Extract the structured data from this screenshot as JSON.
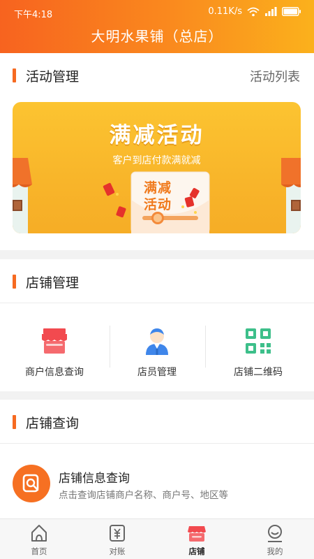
{
  "status_bar": {
    "time": "下午4:18",
    "network_speed": "0.11K/s",
    "battery_level": 1.0
  },
  "header": {
    "title": "大明水果铺（总店）"
  },
  "activity": {
    "section_title": "活动管理",
    "list_link": "活动列表",
    "banner": {
      "title": "满减活动",
      "subtitle": "客户到店付款满就减",
      "envelope_line1": "满减",
      "envelope_line2": "活动"
    }
  },
  "store_mgmt": {
    "section_title": "店铺管理",
    "items": [
      {
        "label": "商户信息查询",
        "icon": "shop-awning-icon"
      },
      {
        "label": "店员管理",
        "icon": "clerk-icon"
      },
      {
        "label": "店铺二维码",
        "icon": "qrcode-icon"
      }
    ]
  },
  "store_query": {
    "section_title": "店铺查询",
    "item": {
      "title": "店铺信息查询",
      "desc": "点击查询店铺商户名称、商户号、地区等",
      "icon": "search-store-icon"
    }
  },
  "tabbar": {
    "tabs": [
      {
        "label": "首页",
        "icon": "home-icon"
      },
      {
        "label": "对账",
        "icon": "bill-icon"
      },
      {
        "label": "店铺",
        "icon": "store-icon",
        "active": true
      },
      {
        "label": "我的",
        "icon": "profile-icon"
      }
    ]
  },
  "colors": {
    "accent": "#f66a21",
    "header_start": "#f7631f",
    "header_end": "#fbb11c",
    "banner": "#fbc02d",
    "qrcode": "#3dbf8a",
    "clerk": "#3f86ea"
  }
}
